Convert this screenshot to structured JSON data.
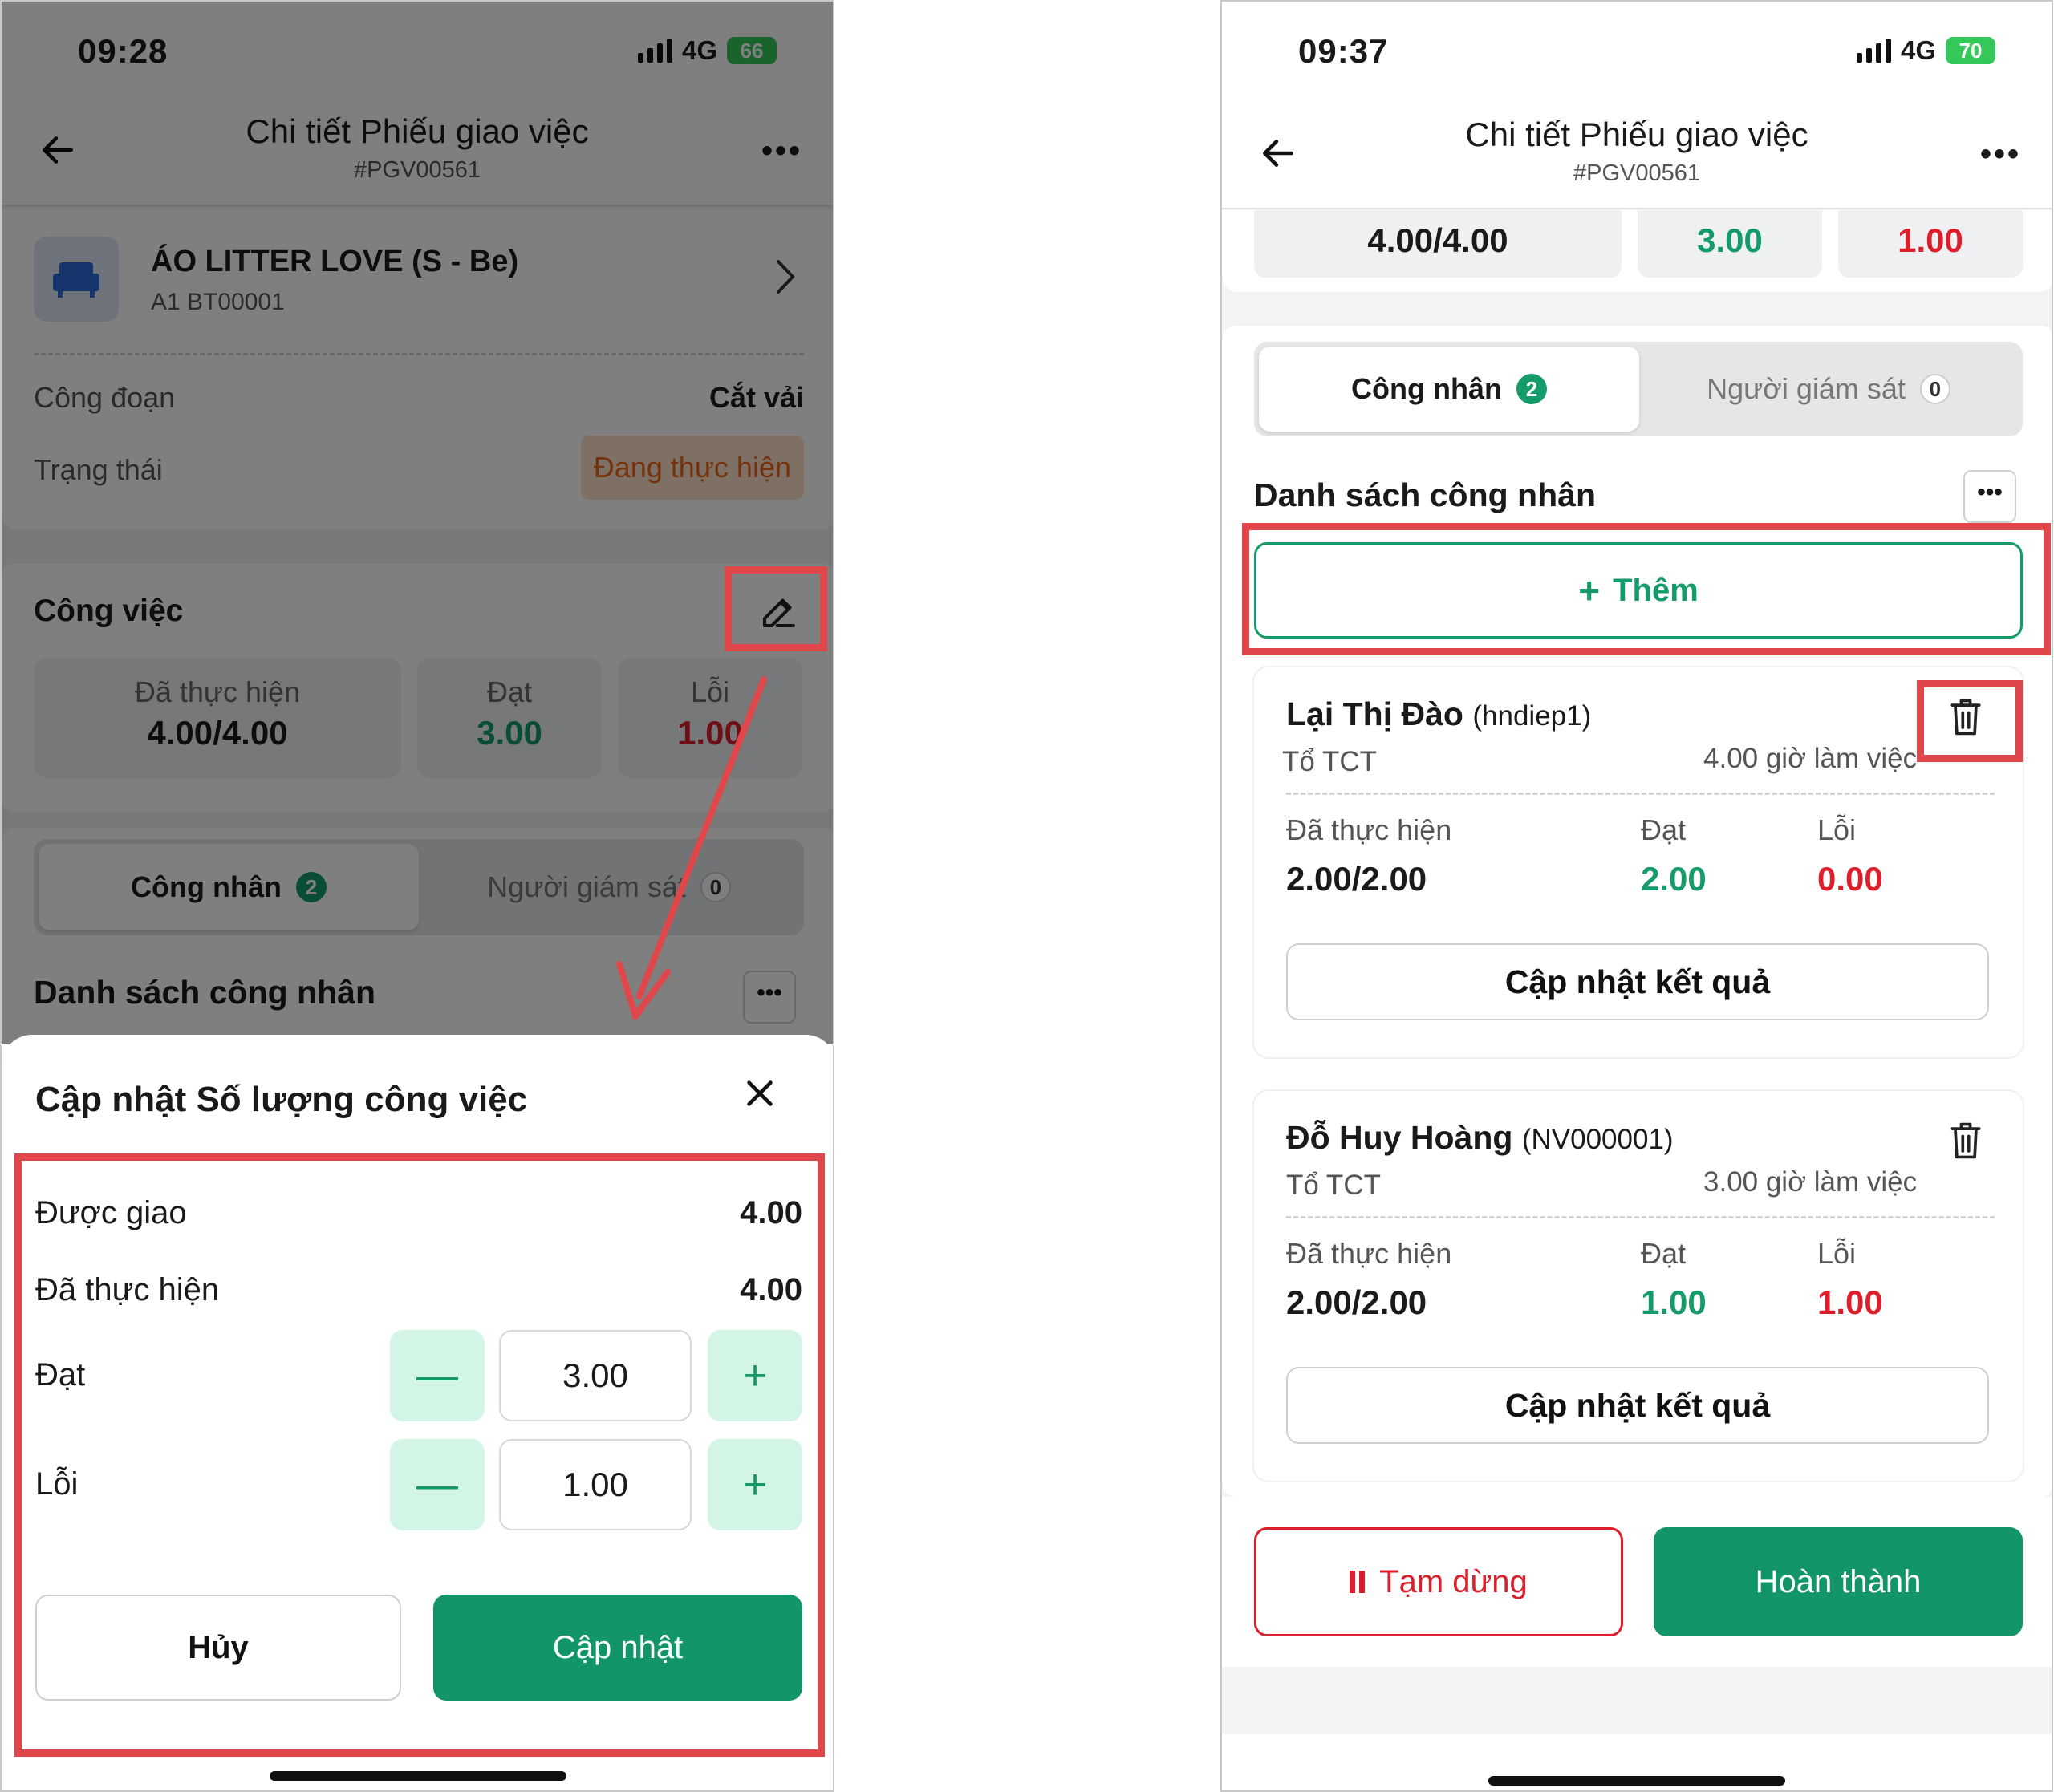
{
  "left": {
    "status": {
      "time": "09:28",
      "network": "4G",
      "battery": "66"
    },
    "header": {
      "title": "Chi tiết Phiếu giao việc",
      "code": "#PGV00561"
    },
    "product": {
      "name": "ÁO LITTER LOVE (S - Be)",
      "code": "A1 BT00001"
    },
    "info": {
      "stage_label": "Công đoạn",
      "stage_value": "Cắt vải",
      "status_label": "Trạng thái",
      "status_value": "Đang thực hiện"
    },
    "work": {
      "title": "Công việc",
      "done_label": "Đã thực hiện",
      "done_value": "4.00/4.00",
      "pass_label": "Đạt",
      "pass_value": "3.00",
      "fail_label": "Lỗi",
      "fail_value": "1.00"
    },
    "tabs": {
      "workers_label": "Công nhân",
      "workers_count": "2",
      "supervisors_label": "Người giám sát",
      "supervisors_count": "0"
    },
    "list_title": "Danh sách công nhân",
    "sheet": {
      "title": "Cập nhật Số lượng công việc",
      "assigned_label": "Được giao",
      "assigned_value": "4.00",
      "done_label": "Đã thực hiện",
      "done_value": "4.00",
      "pass_label": "Đạt",
      "pass_value": "3.00",
      "fail_label": "Lỗi",
      "fail_value": "1.00",
      "cancel_label": "Hủy",
      "update_label": "Cập nhật"
    }
  },
  "right": {
    "status": {
      "time": "09:37",
      "network": "4G",
      "battery": "70"
    },
    "header": {
      "title": "Chi tiết Phiếu giao việc",
      "code": "#PGV00561"
    },
    "summary": {
      "done_value": "4.00/4.00",
      "pass_value": "3.00",
      "fail_value": "1.00"
    },
    "tabs": {
      "workers_label": "Công nhân",
      "workers_count": "2",
      "supervisors_label": "Người giám sát",
      "supervisors_count": "0"
    },
    "list_title": "Danh sách công nhân",
    "add_label": "Thêm",
    "workers": [
      {
        "name": "Lại Thị Đào",
        "code": "(hndiep1)",
        "team": "Tổ TCT",
        "hours": "4.00 giờ làm việc",
        "done_label": "Đã thực hiện",
        "done_value": "2.00/2.00",
        "pass_label": "Đạt",
        "pass_value": "2.00",
        "fail_label": "Lỗi",
        "fail_value": "0.00",
        "update_label": "Cập nhật kết quả"
      },
      {
        "name": "Đỗ Huy Hoàng",
        "code": "(NV000001)",
        "team": "Tổ TCT",
        "hours": "3.00 giờ làm việc",
        "done_label": "Đã thực hiện",
        "done_value": "2.00/2.00",
        "pass_label": "Đạt",
        "pass_value": "1.00",
        "fail_label": "Lỗi",
        "fail_value": "1.00",
        "update_label": "Cập nhật kết quả"
      }
    ],
    "pause_label": "Tạm dừng",
    "complete_label": "Hoàn thành"
  },
  "colors": {
    "primary": "#13956a",
    "danger": "#dd1f2b",
    "highlight": "#e0474a",
    "status_bg": "#fde0c8"
  }
}
